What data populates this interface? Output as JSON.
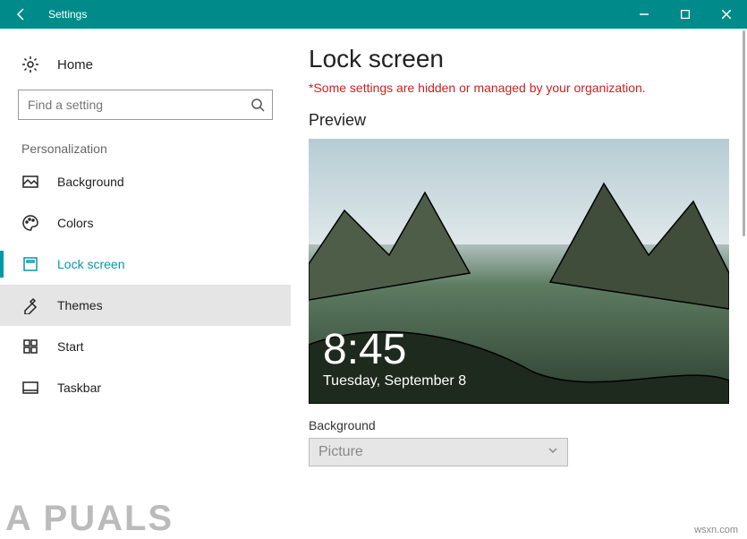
{
  "titlebar": {
    "title": "Settings"
  },
  "sidebar": {
    "home": "Home",
    "search_placeholder": "Find a setting",
    "category": "Personalization",
    "items": [
      {
        "label": "Background"
      },
      {
        "label": "Colors"
      },
      {
        "label": "Lock screen"
      },
      {
        "label": "Themes"
      },
      {
        "label": "Start"
      },
      {
        "label": "Taskbar"
      }
    ]
  },
  "main": {
    "title": "Lock screen",
    "warning": "*Some settings are hidden or managed by your organization.",
    "preview_label": "Preview",
    "clock": "8:45",
    "date": "Tuesday, September 8",
    "background_label": "Background",
    "background_value": "Picture"
  },
  "watermark": {
    "logo": "A   PUALS",
    "url": "wsxn.com"
  }
}
